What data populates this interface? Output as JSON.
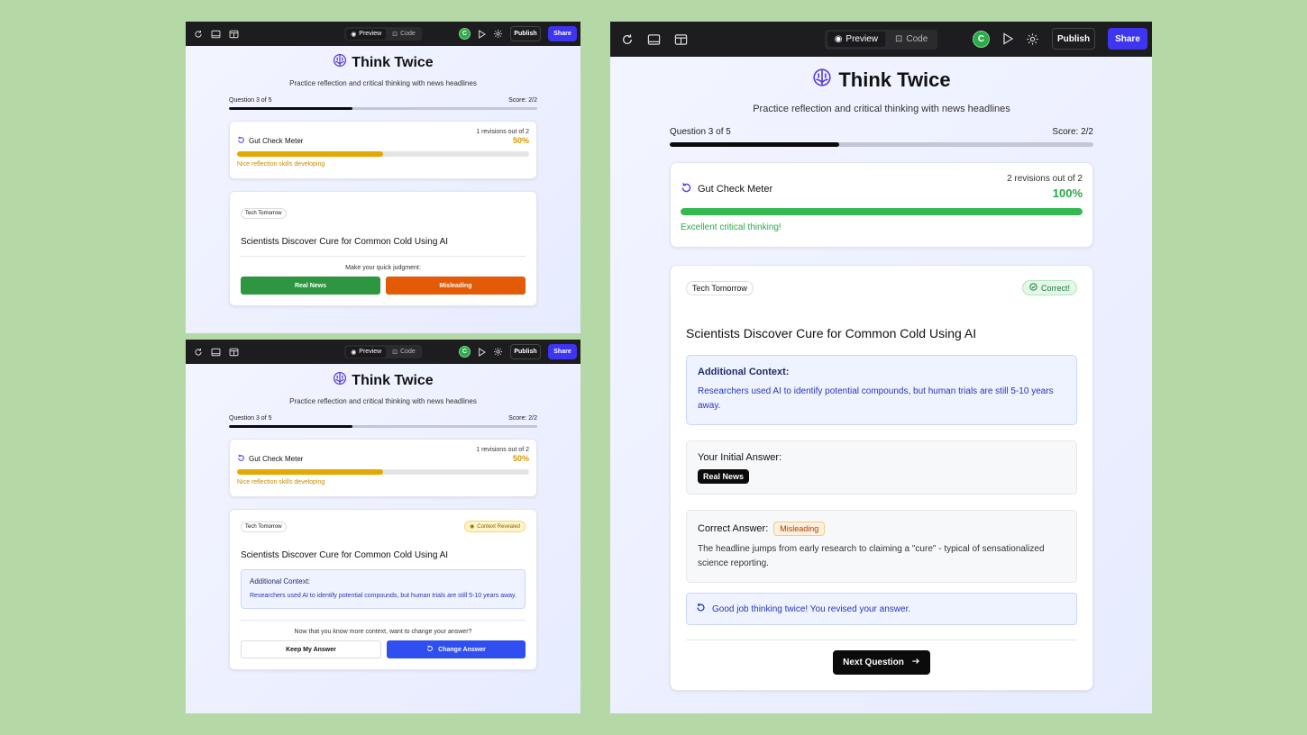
{
  "toolbar": {
    "preview_label": "Preview",
    "code_label": "Code",
    "avatar_initial": "C",
    "publish_label": "Publish",
    "share_label": "Share"
  },
  "app": {
    "title": "Think Twice",
    "subtitle": "Practice reflection and critical thinking with news headlines",
    "question_label": "Question 3 of 5",
    "score_label": "Score: 2/2",
    "progress_fraction": 0.4
  },
  "panel_a": {
    "meter_title": "Gut Check Meter",
    "revisions": "1 revisions out of 2",
    "percent": "50%",
    "meter_fraction": 0.5,
    "message": "Nice reflection skills developing",
    "meter_color": "#e5a800",
    "source": "Tech Tomorrow",
    "headline": "Scientists Discover Cure for Common Cold Using AI",
    "prompt": "Make your quick judgment:",
    "real_label": "Real News",
    "misleading_label": "Misleading"
  },
  "panel_b": {
    "meter_title": "Gut Check Meter",
    "revisions": "1 revisions out of 2",
    "percent": "50%",
    "meter_fraction": 0.5,
    "message": "Nice reflection skills developing",
    "source": "Tech Tomorrow",
    "status": "Context Revealed",
    "headline": "Scientists Discover Cure for Common Cold Using AI",
    "context_title": "Additional Context:",
    "context_text": "Researchers used AI to identify potential compounds, but human trials are still 5-10 years away.",
    "prompt": "Now that you know more context, want to change your answer?",
    "keep_label": "Keep My Answer",
    "change_label": "Change Answer"
  },
  "panel_c": {
    "meter_title": "Gut Check Meter",
    "revisions": "2 revisions out of 2",
    "percent": "100%",
    "meter_fraction": 1.0,
    "message": "Excellent critical thinking!",
    "meter_color": "#33b950",
    "source": "Tech Tomorrow",
    "status": "Correct!",
    "headline": "Scientists Discover Cure for Common Cold Using AI",
    "context_title": "Additional Context:",
    "context_text": "Researchers used AI to identify potential compounds, but human trials are still 5-10 years away.",
    "initial_title": "Your Initial Answer:",
    "initial_value": "Real News",
    "correct_title": "Correct Answer:",
    "correct_value": "Misleading",
    "explanation": "The headline jumps from early research to claiming a \"cure\" - typical of sensationalized science reporting.",
    "feedback": "Good job thinking twice! You revised your answer.",
    "next_label": "Next Question"
  }
}
